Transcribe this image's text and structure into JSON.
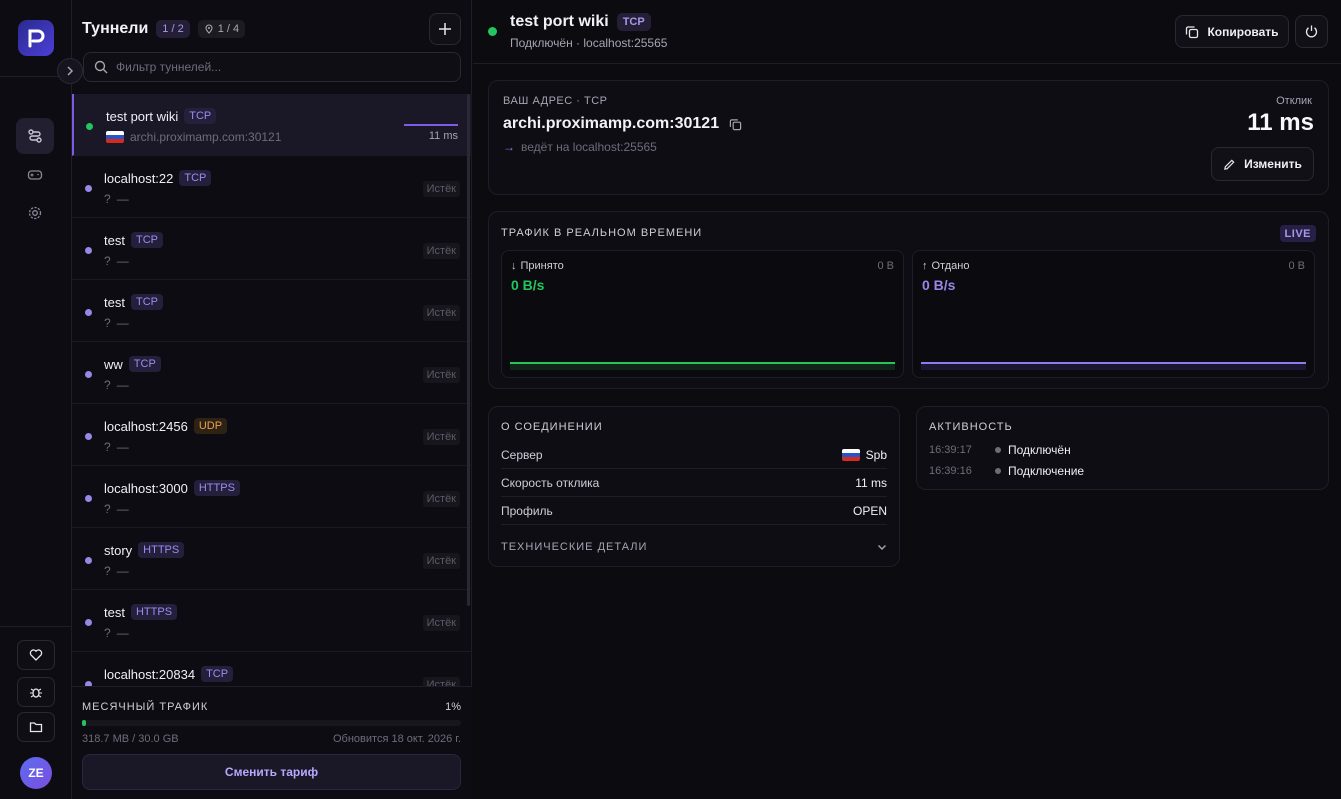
{
  "sidebar": {
    "avatar_initials": "ZE"
  },
  "tunnels_panel": {
    "title": "Туннели",
    "count_badge": "1 / 2",
    "locations_badge": "1 / 4",
    "search_placeholder": "Фильтр туннелей...",
    "items": [
      {
        "name": "test port wiki",
        "protocol": "TCP",
        "address": "archi.proximamp.com:30121",
        "ping": "11 ms",
        "status": "online",
        "selected": true
      },
      {
        "name": "localhost:22",
        "protocol": "TCP",
        "q": "?",
        "dash": "—",
        "expired": "Истёк"
      },
      {
        "name": "test",
        "protocol": "TCP",
        "q": "?",
        "dash": "—",
        "expired": "Истёк"
      },
      {
        "name": "test",
        "protocol": "TCP",
        "q": "?",
        "dash": "—",
        "expired": "Истёк"
      },
      {
        "name": "ww",
        "protocol": "TCP",
        "q": "?",
        "dash": "—",
        "expired": "Истёк"
      },
      {
        "name": "localhost:2456",
        "protocol": "UDP",
        "q": "?",
        "dash": "—",
        "expired": "Истёк"
      },
      {
        "name": "localhost:3000",
        "protocol": "HTTPS",
        "q": "?",
        "dash": "—",
        "expired": "Истёк"
      },
      {
        "name": "story",
        "protocol": "HTTPS",
        "q": "?",
        "dash": "—",
        "expired": "Истёк"
      },
      {
        "name": "test",
        "protocol": "HTTPS",
        "q": "?",
        "dash": "—",
        "expired": "Истёк"
      },
      {
        "name": "localhost:20834",
        "protocol": "TCP",
        "q": "?",
        "dash": "—",
        "expired": "Истёк"
      }
    ],
    "traffic": {
      "label": "МЕСЯЧНЫЙ ТРАФИК",
      "percent": "1%",
      "fill_fraction": 0.01,
      "used": "318.7 MB / 30.0 GB",
      "renew": "Обновится 18 окт. 2026 г.",
      "plan_button": "Сменить тариф"
    }
  },
  "main": {
    "title": "test port wiki",
    "protocol": "TCP",
    "subtitle": "Подключён · localhost:25565",
    "copy_button": "Копировать",
    "address_card": {
      "caption": "ВАШ АДРЕС · TCP",
      "address": "archi.proximamp.com:30121",
      "forward": "ведёт на localhost:25565",
      "latency_caption": "Отклик",
      "latency": "11 ms",
      "edit_button": "Изменить"
    },
    "live": {
      "caption": "ТРАФИК В РЕАЛЬНОМ ВРЕМЕНИ",
      "badge": "LIVE",
      "received_label": "Принято",
      "received_total": "0 B",
      "received_rate": "0 B/s",
      "sent_label": "Отдано",
      "sent_total": "0 B",
      "sent_rate": "0 B/s"
    },
    "connection": {
      "caption": "О СОЕДИНЕНИИ",
      "server_label": "Сервер",
      "server_value": "Spb",
      "latency_label": "Скорость отклика",
      "latency_value": "11 ms",
      "profile_label": "Профиль",
      "profile_value": "OPEN",
      "tech_details": "ТЕХНИЧЕСКИЕ ДЕТАЛИ"
    },
    "activity": {
      "caption": "АКТИВНОСТЬ",
      "events": [
        {
          "time": "16:39:17",
          "event": "Подключён"
        },
        {
          "time": "16:39:16",
          "event": "Подключение"
        }
      ]
    }
  },
  "colors": {
    "accent": "#7c5ce6",
    "online": "#22c55e",
    "received": "#22c55e",
    "sent": "#9a86e6"
  }
}
